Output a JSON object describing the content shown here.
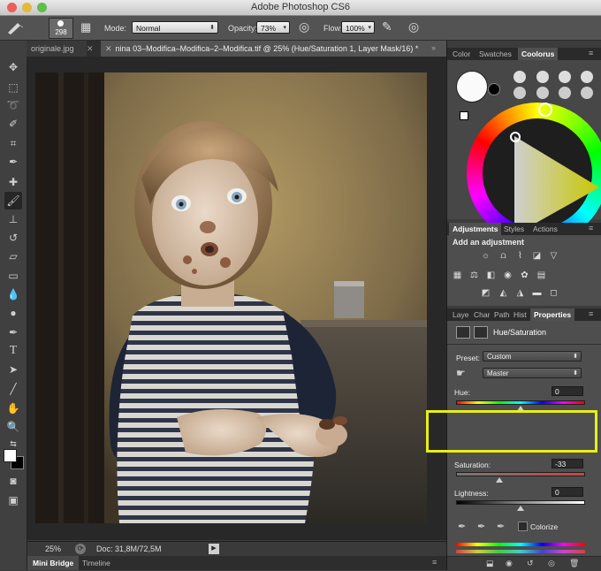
{
  "window": {
    "title": "Adobe Photoshop CS6"
  },
  "options": {
    "brush_size": "298",
    "mode_label": "Mode:",
    "mode_value": "Normal",
    "opacity_label": "Opacity:",
    "opacity_value": "73%",
    "flow_label": "Flow:",
    "flow_value": "100%"
  },
  "tabs": [
    {
      "label": "originale.jpg"
    },
    {
      "label": "nina 03–Modifica–Modifica–2–Modifica.tif @ 25% (Hue/Saturation 1, Layer Mask/16) *"
    }
  ],
  "status": {
    "zoom": "25%",
    "doc": "Doc: 31,8M/72,5M"
  },
  "bottom_tabs": [
    "Mini Bridge",
    "Timeline"
  ],
  "color_panel": {
    "tabs": [
      "Color",
      "Swatches",
      "Coolorus"
    ],
    "active": "Coolorus"
  },
  "adjustments_panel": {
    "tabs": [
      "Adjustments",
      "Styles",
      "Actions"
    ],
    "heading": "Add an adjustment"
  },
  "properties_panel": {
    "tabs": [
      "Laye",
      "Char",
      "Path",
      "Hist",
      "Properties"
    ],
    "title": "Hue/Saturation",
    "preset_label": "Preset:",
    "preset_value": "Custom",
    "channel_value": "Master",
    "hue_label": "Hue:",
    "hue_value": "0",
    "saturation_label": "Saturation:",
    "saturation_value": "-33",
    "saturation_fraction": 0.335,
    "lightness_label": "Lightness:",
    "lightness_value": "0",
    "colorize_label": "Colorize"
  },
  "colors": {
    "highlight": "#e8ee17",
    "panel_bg": "#4e4e4e"
  }
}
